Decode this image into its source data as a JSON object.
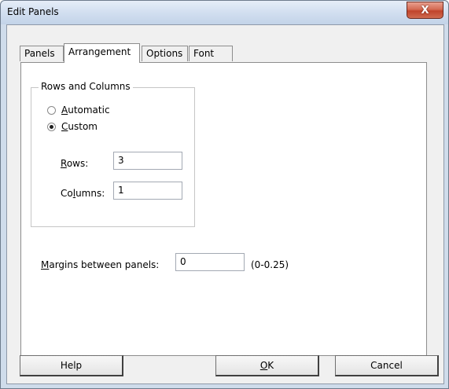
{
  "window": {
    "title": "Edit Panels",
    "close_glyph": "X"
  },
  "tabs": [
    {
      "label": "Panels",
      "active": false
    },
    {
      "label": "Arrangement",
      "active": true
    },
    {
      "label": "Options",
      "active": false
    },
    {
      "label": "Font",
      "active": false
    }
  ],
  "rows_columns": {
    "group_label": "Rows and Columns",
    "automatic": {
      "label_pre": "",
      "label_key": "A",
      "label_post": "utomatic",
      "selected": false
    },
    "custom": {
      "label_pre": "",
      "label_key": "C",
      "label_post": "ustom",
      "selected": true
    },
    "rows": {
      "label_pre": "",
      "label_key": "R",
      "label_post": "ows:",
      "value": "3"
    },
    "columns": {
      "label_pre": "Co",
      "label_key": "l",
      "label_post": "umns:",
      "value": "1"
    }
  },
  "margins": {
    "label_pre": "",
    "label_key": "M",
    "label_post": "argins between panels:",
    "value": "0",
    "range": "(0-0.25)"
  },
  "buttons": {
    "help": "Help",
    "ok_key": "O",
    "ok_post": "K",
    "cancel": "Cancel"
  },
  "icons": [
    "close-icon",
    "radio-icon"
  ]
}
